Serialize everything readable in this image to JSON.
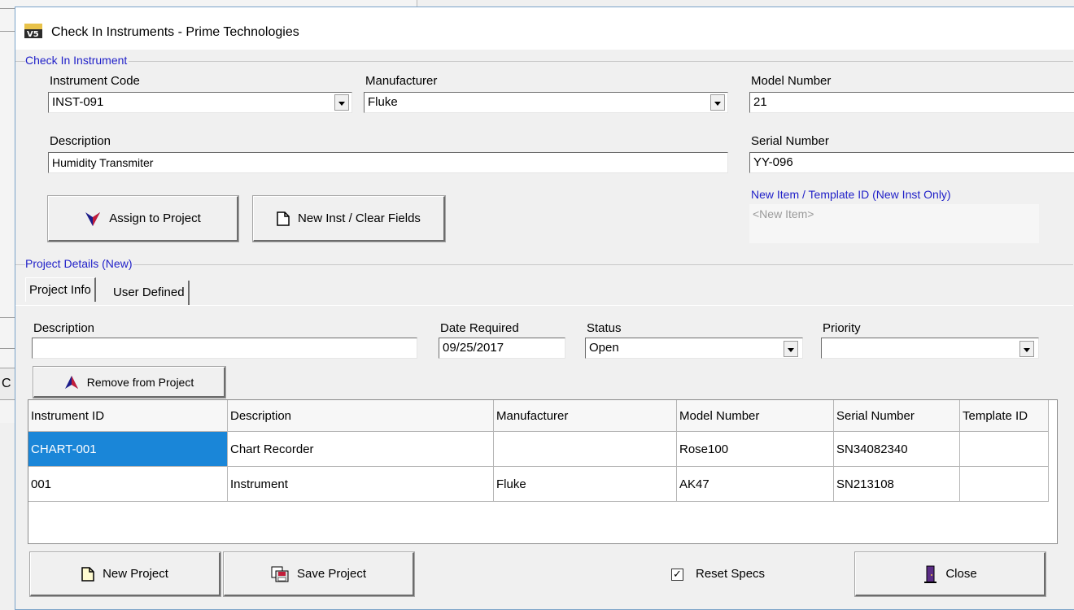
{
  "background": {
    "fragment_char": "C"
  },
  "window": {
    "title": "Check In Instruments - Prime Technologies"
  },
  "check_in": {
    "group_label": "Check In Instrument",
    "instrument_code": {
      "label": "Instrument Code",
      "value": "INST-091"
    },
    "manufacturer": {
      "label": "Manufacturer",
      "value": "Fluke"
    },
    "model_number": {
      "label": "Model Number",
      "value": "21"
    },
    "description": {
      "label": "Description",
      "value": "Humidity Transmiter"
    },
    "serial_number": {
      "label": "Serial Number",
      "value": "YY-096"
    },
    "template": {
      "label": "New Item / Template ID (New Inst Only)",
      "value": "<New Item>"
    },
    "assign_button": "Assign to Project",
    "new_inst_button": "New Inst / Clear Fields"
  },
  "project": {
    "group_label": "Project Details (New)",
    "tabs": [
      "Project Info",
      "User Defined"
    ],
    "description": {
      "label": "Description",
      "value": ""
    },
    "date_required": {
      "label": "Date Required",
      "value": "09/25/2017"
    },
    "status": {
      "label": "Status",
      "value": "Open"
    },
    "priority": {
      "label": "Priority",
      "value": ""
    },
    "remove_button": "Remove from Project"
  },
  "table": {
    "columns": [
      "Instrument ID",
      "Description",
      "Manufacturer",
      "Model Number",
      "Serial Number",
      "Template ID"
    ],
    "rows": [
      [
        "CHART-001",
        "Chart Recorder",
        "",
        "Rose100",
        "SN34082340",
        ""
      ],
      [
        "001",
        "Instrument",
        "Fluke",
        "AK47",
        "SN213108",
        ""
      ]
    ]
  },
  "footer": {
    "new_project": "New Project",
    "save_project": "Save Project",
    "reset_specs": "Reset Specs",
    "reset_specs_checked": true,
    "close": "Close"
  },
  "colors": {
    "accent": "#1f1fc8",
    "selection": "#1a86d8"
  },
  "icons": [
    "app-v5-icon",
    "assign-down-arrow-icon",
    "new-document-icon",
    "remove-up-arrow-icon",
    "save-project-icon",
    "close-door-icon",
    "dropdown-arrow-icon"
  ]
}
